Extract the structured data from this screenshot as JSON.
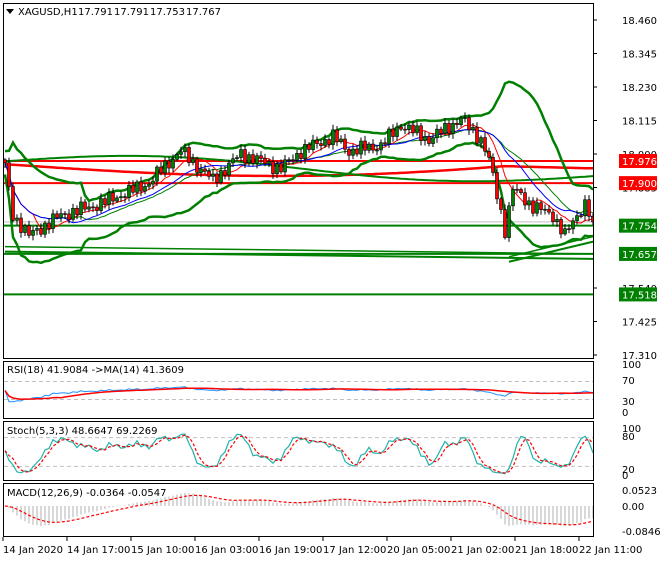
{
  "chart_data": {
    "type": "candlestick",
    "header": {
      "symbol": "XAGUSD,H1",
      "open": "17.791",
      "high": "17.791",
      "low": "17.753",
      "close": "17.767"
    },
    "price_axis": {
      "ticks": [
        "18.460",
        "18.345",
        "18.230",
        "18.115",
        "18.000",
        "17.885",
        "17.540",
        "17.425",
        "17.310"
      ],
      "range": [
        17.31,
        18.46
      ]
    },
    "time_axis": {
      "ticks": [
        "14 Jan 2020",
        "14 Jan 17:00",
        "15 Jan 10:00",
        "16 Jan 03:00",
        "16 Jan 19:00",
        "17 Jan 12:00",
        "20 Jan 05:00",
        "21 Jan 02:00",
        "21 Jan 18:00",
        "22 Jan 11:00"
      ],
      "bars_per_tick": 16,
      "bar_count": 148
    },
    "close_anchors": [
      [
        0,
        17.96
      ],
      [
        2,
        17.79
      ],
      [
        6,
        17.72
      ],
      [
        14,
        17.79
      ],
      [
        24,
        17.83
      ],
      [
        36,
        17.9
      ],
      [
        40,
        17.96
      ],
      [
        44,
        18.01
      ],
      [
        52,
        17.91
      ],
      [
        59,
        18.0
      ],
      [
        69,
        17.95
      ],
      [
        74,
        18.01
      ],
      [
        82,
        18.06
      ],
      [
        86,
        18.01
      ],
      [
        94,
        18.03
      ],
      [
        99,
        18.1
      ],
      [
        106,
        18.05
      ],
      [
        114,
        18.12
      ],
      [
        119,
        18.05
      ],
      [
        121,
        17.98
      ],
      [
        125,
        17.74
      ],
      [
        127,
        17.88
      ],
      [
        132,
        17.82
      ],
      [
        137,
        17.79
      ],
      [
        140,
        17.72
      ],
      [
        143,
        17.79
      ],
      [
        145,
        17.83
      ],
      [
        147,
        17.767
      ]
    ],
    "levels": [
      {
        "price": 17.976,
        "label": "17.976",
        "color": "#ff0000"
      },
      {
        "price": 17.9,
        "label": "17.900",
        "color": "#ff0000"
      },
      {
        "price": 17.754,
        "label": "17.754",
        "color": "#008000"
      },
      {
        "price": 17.657,
        "label": "17.657",
        "color": "#008000"
      },
      {
        "price": 17.518,
        "label": "17.518",
        "color": "#008000"
      }
    ],
    "current_price": 17.767,
    "trendlines": [
      {
        "from": [
          0,
          17.665
        ],
        "to": [
          147,
          17.64
        ],
        "color": "#008000"
      },
      {
        "from": [
          126,
          17.63
        ],
        "to": [
          164,
          17.755
        ],
        "color": "#008000"
      }
    ],
    "colors": {
      "bull": "#008000",
      "bear": "#ff0000",
      "bands": "#008000",
      "ma_fast": "#ff0000",
      "ma_slow": "#0000ff",
      "long_ma": "#ff0000"
    },
    "rsi": {
      "label": "RSI(18) 41.9084  ->MA(14) 41.3609",
      "ticks": [
        "100",
        "70",
        "30",
        "0"
      ]
    },
    "stoch": {
      "label": "Stoch(5,3,3) 48.6647 69.2269",
      "ticks": [
        "100",
        "80",
        "20",
        "0"
      ]
    },
    "macd": {
      "label": "MACD(12,26,9) -0.0364 -0.0547",
      "ticks": [
        "0.0523",
        "0.00",
        "-0.0846"
      ],
      "range": [
        -0.0846,
        0.0523
      ]
    }
  }
}
